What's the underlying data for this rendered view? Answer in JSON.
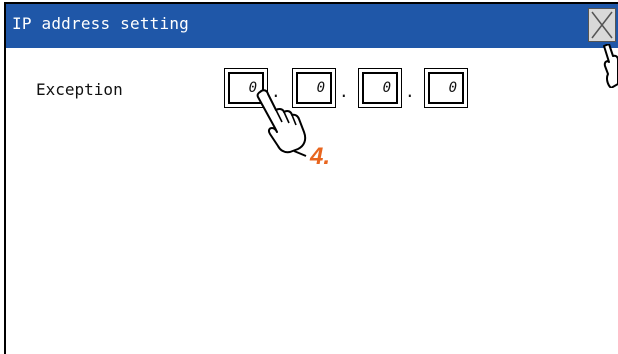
{
  "window": {
    "title": "IP address setting"
  },
  "close_button": {
    "icon": "close-icon"
  },
  "exception": {
    "label": "Exception",
    "octets": [
      "0",
      "0",
      "0",
      "0"
    ],
    "separator": "."
  },
  "annotation": {
    "step": "4."
  },
  "colors": {
    "titlebar": "#1f57a8",
    "step": "#e8651e"
  }
}
